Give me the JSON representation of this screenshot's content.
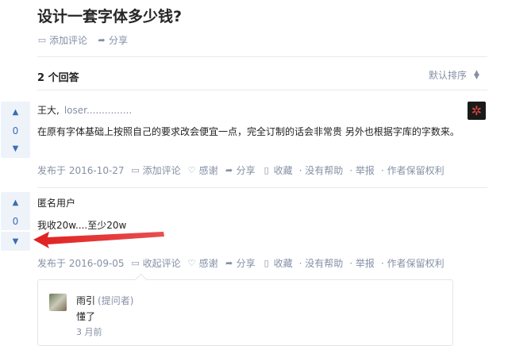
{
  "question": {
    "title": "设计一套字体多少钱?",
    "add_comment": "添加评论",
    "share": "分享"
  },
  "answers_header": {
    "count": "2 个回答",
    "sort": "默认排序"
  },
  "answers": [
    {
      "votes": "0",
      "author": "王大,",
      "bio": "loser...............",
      "content": "在原有字体基础上按照自己的要求改会便宜一点，完全订制的话会非常贵 另外也根据字库的字数来。",
      "date": "发布于 2016-10-27",
      "comment": "添加评论",
      "thanks": "感谢",
      "share": "分享",
      "collect": "收藏",
      "no_help": "没有帮助",
      "report": "举报",
      "copyright": "作者保留权利"
    },
    {
      "votes": "0",
      "author": "匿名用户",
      "content": "我收20w....至少20w",
      "date": "发布于 2016-09-05",
      "comment": "收起评论",
      "thanks": "感谢",
      "share": "分享",
      "collect": "收藏",
      "no_help": "没有帮助",
      "report": "举报",
      "copyright": "作者保留权利"
    }
  ],
  "comment": {
    "name": "雨引",
    "role": "(提问者)",
    "text": "懂了",
    "time": "3 月前"
  },
  "colors": {
    "accent": "#3b6db3",
    "meta": "#8590a6",
    "annotation_arrow": "#e02020"
  }
}
